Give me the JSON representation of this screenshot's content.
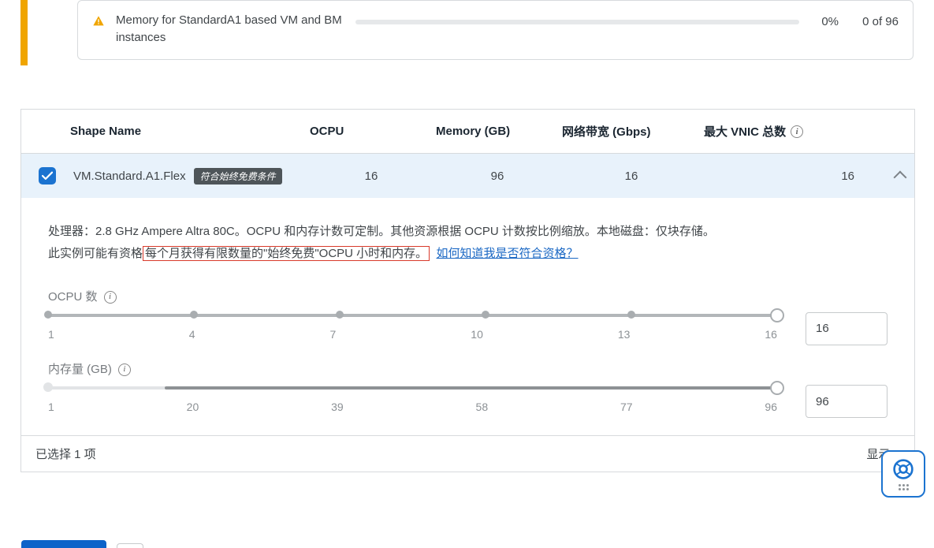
{
  "warning": {
    "text": "Memory for StandardA1 based VM and BM instances",
    "percent": "0%",
    "count": "0 of 96"
  },
  "table": {
    "headers": {
      "shape_name": "Shape Name",
      "ocpu": "OCPU",
      "memory": "Memory (GB)",
      "bandwidth": "网络带宽 (Gbps)",
      "max_vnic": "最大 VNIC 总数"
    },
    "row": {
      "shape_name": "VM.Standard.A1.Flex",
      "free_badge": "符合始终免费条件",
      "ocpu": "16",
      "memory": "96",
      "bandwidth": "16",
      "max_vnic": "16"
    }
  },
  "detail": {
    "desc1": "处理器：2.8 GHz Ampere Altra 80C。OCPU 和内存计数可定制。其他资源根据 OCPU 计数按比例缩放。本地磁盘：仅块存储。",
    "desc2_prefix": "此实例可能有资格",
    "desc2_boxed": "每个月获得有限数量的\"始终免费\"OCPU 小时和内存。",
    "link": "如何知道我是否符合资格？",
    "ocpu": {
      "label": "OCPU 数",
      "ticks": [
        "1",
        "4",
        "7",
        "10",
        "13",
        "16"
      ],
      "value": "16"
    },
    "memory": {
      "label": "内存量 (GB)",
      "ticks": [
        "1",
        "20",
        "39",
        "58",
        "77",
        "96"
      ],
      "value": "96"
    }
  },
  "footer": {
    "selected": "已选择 1 项",
    "showing": "显示 1"
  }
}
